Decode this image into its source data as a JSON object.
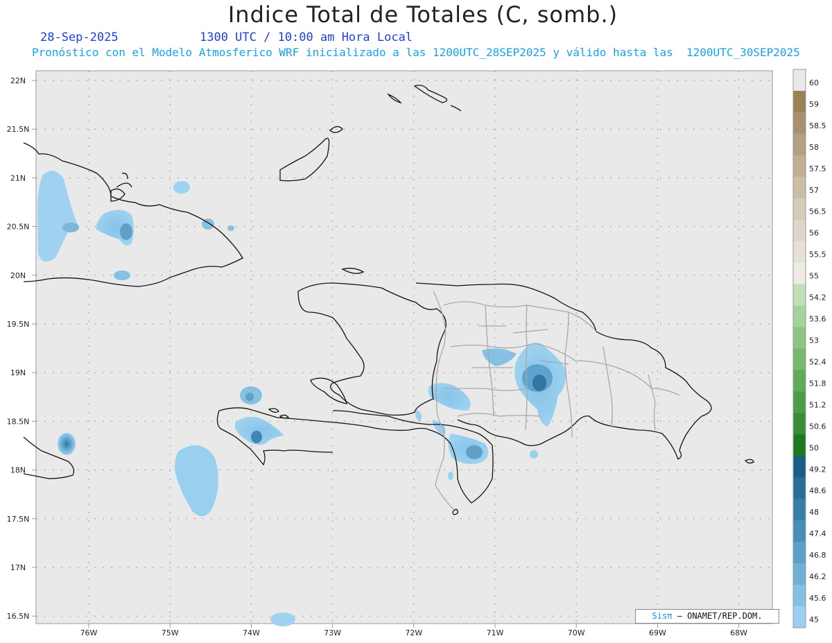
{
  "header": {
    "title": "Indice Total de Totales (C, somb.)",
    "date": "28-Sep-2025",
    "time": "1300 UTC / 10:00 am Hora Local",
    "forecast": "Pronóstico con el Modelo Atmosferico WRF inicializado a las 1200UTC_28SEP2025 y válido hasta las  1200UTC_30SEP2025"
  },
  "axes": {
    "lat_labels": [
      "22N",
      "21.5N",
      "21N",
      "20.5N",
      "20N",
      "19.5N",
      "19N",
      "18.5N",
      "18N",
      "17.5N",
      "17N",
      "16.5N"
    ],
    "lon_labels": [
      "76W",
      "75W",
      "74W",
      "73W",
      "72W",
      "71W",
      "70W",
      "69W",
      "68W"
    ]
  },
  "colorbar": {
    "labels": [
      "60",
      "59",
      "58.5",
      "58",
      "57.5",
      "57",
      "56.5",
      "56",
      "55.5",
      "55",
      "54.2",
      "53.6",
      "53",
      "52.4",
      "51.8",
      "51.2",
      "50.6",
      "50",
      "49.2",
      "48.6",
      "48",
      "47.4",
      "46.8",
      "46.2",
      "45.6",
      "45"
    ],
    "colors": [
      "#e9e9e9",
      "#9a8257",
      "#a89070",
      "#b6a083",
      "#c2ae94",
      "#ccbda6",
      "#d6cab8",
      "#ded6c9",
      "#e6e0d6",
      "#eeeae4",
      "#bfe0b6",
      "#a6d39b",
      "#8ec583",
      "#76b86d",
      "#5fab58",
      "#4b9d46",
      "#388e35",
      "#1e7a20",
      "#1a5e86",
      "#276f99",
      "#347fa8",
      "#4690b8",
      "#5aa0c8",
      "#6eb0d6",
      "#84c0e2",
      "#99d0ef"
    ]
  },
  "credit": {
    "sis": "Sisπ",
    "text": "– ONAMET/REP.DOM."
  }
}
